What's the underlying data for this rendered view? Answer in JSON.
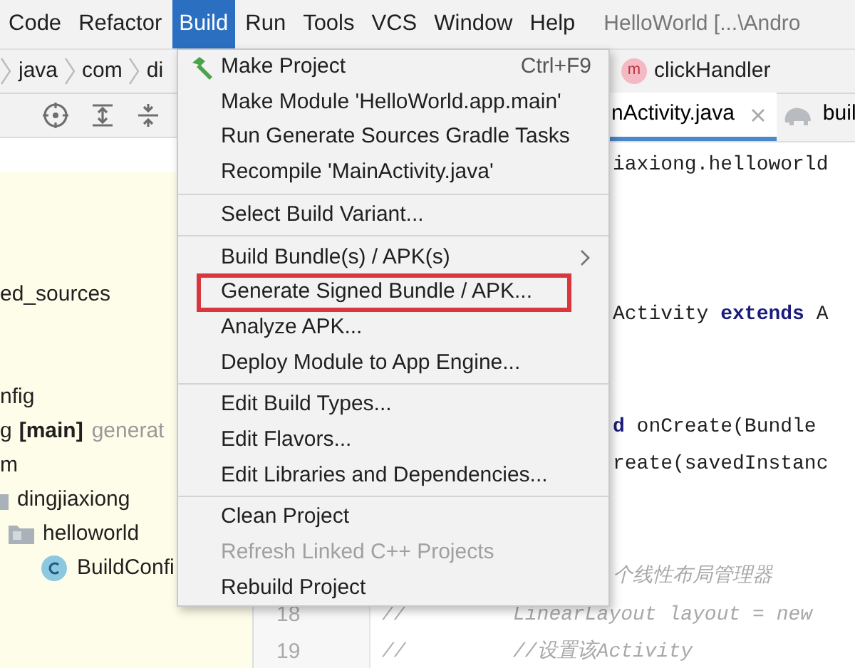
{
  "menubar": [
    {
      "label": "Code",
      "selected": false
    },
    {
      "label": "Refactor",
      "selected": false
    },
    {
      "label": "Build",
      "selected": true
    },
    {
      "label": "Run",
      "selected": false
    },
    {
      "label": "Tools",
      "selected": false
    },
    {
      "label": "VCS",
      "selected": false
    },
    {
      "label": "Window",
      "selected": false
    },
    {
      "label": "Help",
      "selected": false
    }
  ],
  "window_title": "HelloWorld [...\\Andro",
  "breadcrumbs": [
    "java",
    "com",
    "di"
  ],
  "structure_crumb": {
    "icon_letter": "m",
    "label": "clickHandler"
  },
  "editor_tabs": [
    {
      "label": "nActivity.java",
      "selected": true,
      "closable": true
    },
    {
      "label": "buil",
      "selected": false
    }
  ],
  "project_tree": [
    {
      "label": "ed_sources"
    },
    {
      "label": "nfig"
    },
    {
      "label": "g",
      "tag": "[main]",
      "note": "generat"
    },
    {
      "label": "m"
    },
    {
      "label": "dingjiaxiong",
      "kind": "package",
      "children": [
        {
          "label": "helloworld",
          "kind": "package",
          "children": [
            {
              "label": "BuildConfi",
              "kind": "class"
            }
          ]
        }
      ]
    }
  ],
  "code_lines": [
    {
      "kind": "code",
      "text": "iaxiong.helloworld"
    },
    {
      "kind": "blank"
    },
    {
      "kind": "blank"
    },
    {
      "kind": "blank"
    },
    {
      "kind": "code",
      "text": "Activity **extends** A"
    },
    {
      "kind": "blank"
    },
    {
      "kind": "blank"
    },
    {
      "kind": "code",
      "text": "**d** onCreate(Bundle"
    },
    {
      "kind": "code",
      "text": "reate(savedInstanc"
    },
    {
      "kind": "blank"
    },
    {
      "kind": "blank"
    },
    {
      "kind": "comment",
      "text": "个线性布局管理器"
    },
    {
      "kind": "full",
      "number": "18",
      "marker": "//",
      "text": "LinearLayout layout = new"
    },
    {
      "kind": "full",
      "number": "19",
      "marker": "//",
      "text": "//设置该Activity"
    }
  ],
  "build_menu": [
    {
      "kind": "item",
      "label": "Make Project",
      "shortcut": "Ctrl+F9",
      "icon": true
    },
    {
      "kind": "item",
      "label": "Make Module 'HelloWorld.app.main'"
    },
    {
      "kind": "item",
      "label": "Run Generate Sources Gradle Tasks"
    },
    {
      "kind": "item",
      "label": "Recompile 'MainActivity.java'"
    },
    {
      "kind": "separator"
    },
    {
      "kind": "item",
      "label": "Select Build Variant..."
    },
    {
      "kind": "separator"
    },
    {
      "kind": "item",
      "label": "Build Bundle(s) / APK(s)",
      "submenu": true
    },
    {
      "kind": "item",
      "label": "Generate Signed Bundle / APK...",
      "outlined": true
    },
    {
      "kind": "item",
      "label": "Analyze APK..."
    },
    {
      "kind": "item",
      "label": "Deploy Module to App Engine..."
    },
    {
      "kind": "separator"
    },
    {
      "kind": "item",
      "label": "Edit Build Types..."
    },
    {
      "kind": "item",
      "label": "Edit Flavors..."
    },
    {
      "kind": "item",
      "label": "Edit Libraries and Dependencies..."
    },
    {
      "kind": "separator"
    },
    {
      "kind": "item",
      "label": "Clean Project"
    },
    {
      "kind": "item",
      "label": "Refresh Linked C++ Projects",
      "disabled": true
    },
    {
      "kind": "item",
      "label": "Rebuild Project"
    }
  ]
}
